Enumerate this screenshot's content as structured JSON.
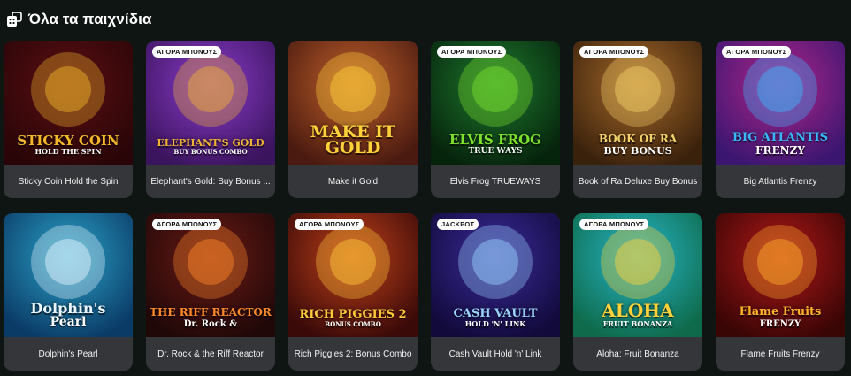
{
  "section": {
    "title": "Όλα τα παιχνίδια",
    "icon": "games-icon"
  },
  "games": [
    {
      "title": "Sticky Coin Hold the Spin",
      "badge": "",
      "logo": "STICKY COIN",
      "logo_sub": "HOLD THE SPIN",
      "bg": [
        "#5a0f12",
        "#2a0507"
      ],
      "accent": "#f3b82a"
    },
    {
      "title": "Elephant's Gold: Buy Bonus ...",
      "badge": "ΑΓΟΡΑ ΜΠΟΝΟΥΣ",
      "logo": "ELEPHANT'S GOLD",
      "logo_sub": "BUY BONUS COMBO",
      "bg": [
        "#8a3bc9",
        "#3b145e"
      ],
      "accent": "#f0b433"
    },
    {
      "title": "Make it Gold",
      "badge": "",
      "logo": "MAKE IT GOLD",
      "logo_sub": "",
      "bg": [
        "#c0602a",
        "#4a1a10"
      ],
      "accent": "#ffd23a"
    },
    {
      "title": "Elvis Frog TRUEWAYS",
      "badge": "ΑΓΟΡΑ ΜΠΟΝΟΥΣ",
      "logo": "ELVIS FROG",
      "logo_sub": "TRUE WAYS",
      "bg": [
        "#1e7a2e",
        "#06230c"
      ],
      "accent": "#7de22e"
    },
    {
      "title": "Book of Ra Deluxe Buy Bonus",
      "badge": "ΑΓΟΡΑ ΜΠΟΝΟΥΣ",
      "logo": "BOOK OF RA",
      "logo_sub": "BUY BONUS",
      "bg": [
        "#a66a2a",
        "#3a210c"
      ],
      "accent": "#f5d26a"
    },
    {
      "title": "Big Atlantis Frenzy",
      "badge": "ΑΓΟΡΑ ΜΠΟΝΟΥΣ",
      "logo": "BIG ATLANTIS",
      "logo_sub": "FRENZY",
      "bg": [
        "#b0258a",
        "#3a1670"
      ],
      "accent": "#39b8ff"
    },
    {
      "title": "Dolphin's Pearl",
      "badge": "",
      "logo": "Dolphin's",
      "logo_sub": "Pearl",
      "bg": [
        "#2aa2c8",
        "#0a3a66"
      ],
      "accent": "#e8f6ff"
    },
    {
      "title": "Dr. Rock & the Riff Reactor",
      "badge": "ΑΓΟΡΑ ΜΠΟΝΟΥΣ",
      "logo": "THE RIFF REACTOR",
      "logo_sub": "Dr. Rock &",
      "bg": [
        "#6a1a14",
        "#200808"
      ],
      "accent": "#ff8a2a"
    },
    {
      "title": "Rich Piggies 2: Bonus Combo",
      "badge": "ΑΓΟΡΑ ΜΠΟΝΟΥΣ",
      "logo": "RICH PIGGIES 2",
      "logo_sub": "BONUS COMBO",
      "bg": [
        "#c0401a",
        "#3a0a08"
      ],
      "accent": "#ffc93a"
    },
    {
      "title": "Cash Vault Hold 'n' Link",
      "badge": "JACKPOT",
      "logo": "CASH VAULT",
      "logo_sub": "HOLD 'N' LINK",
      "bg": [
        "#3a2a9a",
        "#110a3a"
      ],
      "accent": "#9ad4ff"
    },
    {
      "title": "Aloha: Fruit Bonanza",
      "badge": "ΑΓΟΡΑ ΜΠΟΝΟΥΣ",
      "logo": "ALOHA",
      "logo_sub": "FRUIT BONANZA",
      "bg": [
        "#27b5c8",
        "#0e6a4a"
      ],
      "accent": "#ffd23a"
    },
    {
      "title": "Flame Fruits Frenzy",
      "badge": "",
      "logo": "Flame Fruits",
      "logo_sub": "FRENZY",
      "bg": [
        "#b01818",
        "#3a0505"
      ],
      "accent": "#ffb02a"
    }
  ]
}
